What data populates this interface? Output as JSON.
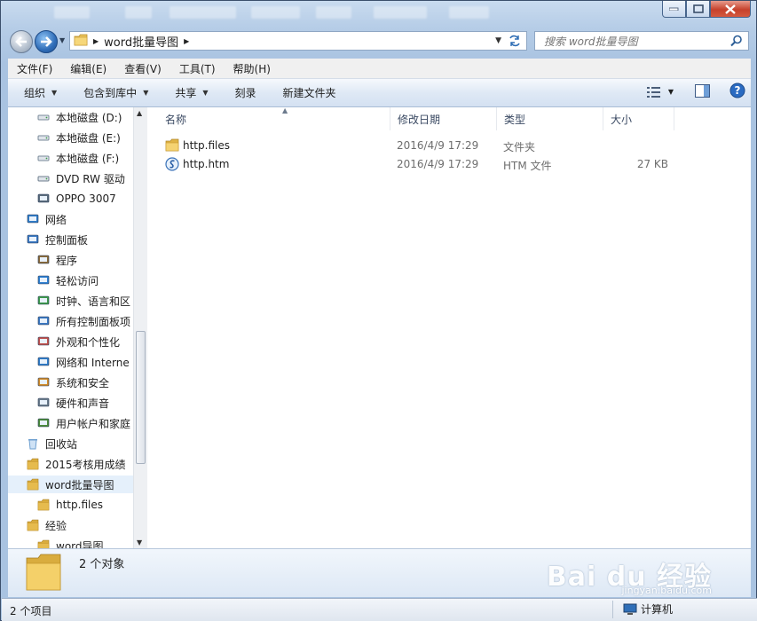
{
  "window": {
    "caption_buttons": [
      "minimize",
      "maximize",
      "close"
    ]
  },
  "address_bar": {
    "path": "word批量导图",
    "search_placeholder": "搜索 word批量导图"
  },
  "menu": [
    "文件(F)",
    "编辑(E)",
    "查看(V)",
    "工具(T)",
    "帮助(H)"
  ],
  "toolbar": {
    "organize": "组织",
    "include_in_library": "包含到库中",
    "share": "共享",
    "burn": "刻录",
    "new_folder": "新建文件夹"
  },
  "nav_pane": {
    "items": [
      {
        "label": "本地磁盘 (D:)",
        "icon": "drive-icon"
      },
      {
        "label": "本地磁盘 (E:)",
        "icon": "drive-icon"
      },
      {
        "label": "本地磁盘 (F:)",
        "icon": "drive-icon"
      },
      {
        "label": "DVD RW 驱动",
        "icon": "dvd-drive-icon"
      },
      {
        "label": "OPPO 3007",
        "icon": "device-icon"
      },
      {
        "label": "网络",
        "icon": "network-icon"
      },
      {
        "label": "控制面板",
        "icon": "control-panel-icon"
      },
      {
        "label": "程序",
        "icon": "programs-icon"
      },
      {
        "label": "轻松访问",
        "icon": "ease-of-access-icon"
      },
      {
        "label": "时钟、语言和区",
        "icon": "clock-language-icon"
      },
      {
        "label": "所有控制面板项",
        "icon": "control-panel-icon"
      },
      {
        "label": "外观和个性化",
        "icon": "appearance-icon"
      },
      {
        "label": "网络和 Interne",
        "icon": "network-internet-icon"
      },
      {
        "label": "系统和安全",
        "icon": "system-security-icon"
      },
      {
        "label": "硬件和声音",
        "icon": "hardware-sound-icon"
      },
      {
        "label": "用户帐户和家庭",
        "icon": "user-accounts-icon"
      },
      {
        "label": "回收站",
        "icon": "recycle-bin-icon"
      },
      {
        "label": "2015考核用成绩",
        "icon": "folder-icon"
      },
      {
        "label": "word批量导图",
        "icon": "folder-icon",
        "selected": true
      },
      {
        "label": "http.files",
        "icon": "folder-icon"
      },
      {
        "label": "经验",
        "icon": "folder-icon"
      },
      {
        "label": "word导图",
        "icon": "folder-icon"
      }
    ]
  },
  "file_list": {
    "columns": [
      "名称",
      "修改日期",
      "类型",
      "大小"
    ],
    "rows": [
      {
        "name": "http.files",
        "date": "2016/4/9 17:29",
        "type": "文件夹",
        "size": "",
        "icon": "folder-icon"
      },
      {
        "name": "http.htm",
        "date": "2016/4/9 17:29",
        "type": "HTM 文件",
        "size": "27 KB",
        "icon": "html-file-icon"
      }
    ]
  },
  "details_pane": {
    "count": "2 个对象"
  },
  "status_bar": {
    "items": "2 个项目",
    "location": "计算机"
  },
  "watermark": {
    "brand": "Bai du 经验",
    "url": "jingyan.baidu.com"
  }
}
